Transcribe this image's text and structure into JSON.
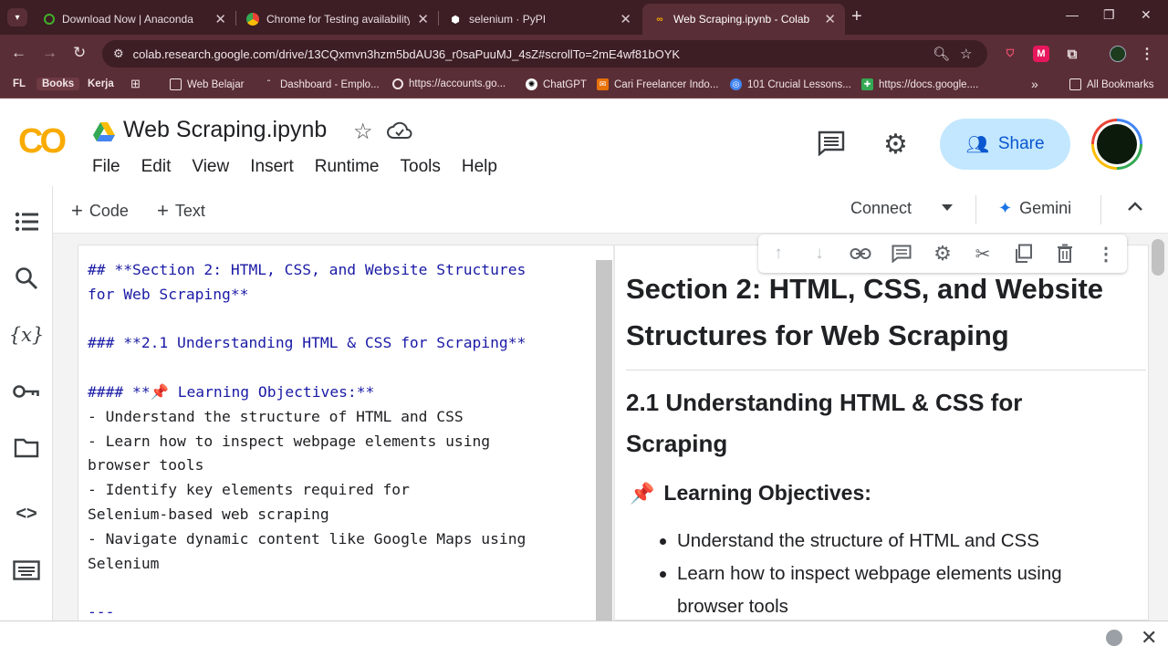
{
  "browser": {
    "tabs": [
      {
        "title": "Download Now | Anaconda",
        "icon": "anaconda-icon",
        "active": false
      },
      {
        "title": "Chrome for Testing availability",
        "icon": "chrome-icon",
        "active": false
      },
      {
        "title": "selenium · PyPI",
        "icon": "pypi-icon",
        "active": false
      },
      {
        "title": "Web Scraping.ipynb - Colab",
        "icon": "colab-icon",
        "active": true
      }
    ],
    "url": "colab.research.google.com/drive/13CQxmvn3hzm5bdAU36_r0saPuuMJ_4sZ#scrollTo=2mE4wf81bOYK",
    "bookmarks": [
      {
        "label": "FL",
        "icon": ""
      },
      {
        "label": "Books",
        "icon": ""
      },
      {
        "label": "Kerja",
        "icon": ""
      },
      {
        "label": "Web Belajar",
        "icon": "folder-icon"
      },
      {
        "label": "Dashboard - Emplo...",
        "icon": "page-icon"
      },
      {
        "label": "https://accounts.go...",
        "icon": "google-icon"
      },
      {
        "label": "ChatGPT",
        "icon": "chatgpt-icon"
      },
      {
        "label": "Cari Freelancer Indo...",
        "icon": "freelancer-icon"
      },
      {
        "label": "101 Crucial Lessons...",
        "icon": "globe-icon"
      },
      {
        "label": "https://docs.google....",
        "icon": "docs-icon"
      }
    ],
    "all_bookmarks": "All Bookmarks",
    "colors": {
      "frame": "#3c1e24",
      "toolbar": "#5a2e36"
    }
  },
  "colab": {
    "logo": "CO",
    "notebook_title": "Web Scraping.ipynb",
    "menu": [
      "File",
      "Edit",
      "View",
      "Insert",
      "Runtime",
      "Tools",
      "Help"
    ],
    "share_label": "Share",
    "toolbar": {
      "code_label": "Code",
      "text_label": "Text",
      "connect_label": "Connect",
      "gemini_label": "Gemini"
    },
    "left_rail_icons": [
      "toc-icon",
      "search-icon",
      "variables-icon",
      "secrets-key-icon",
      "files-folder-icon",
      "code-snippets-icon",
      "command-palette-icon"
    ],
    "cell_toolbar_icons": [
      "move-up-icon",
      "move-down-icon",
      "link-icon",
      "comment-icon",
      "settings-icon",
      "mirror-cell-icon",
      "copy-cell-icon",
      "delete-icon",
      "more-vert-icon"
    ]
  },
  "editor": {
    "lines": [
      "## **Section 2: HTML, CSS, and Website Structures",
      "for Web Scraping**",
      "",
      "### **2.1 Understanding HTML & CSS for Scraping**",
      "",
      "#### **📌 Learning Objectives:**",
      "- Understand the structure of HTML and CSS",
      "- Learn how to inspect webpage elements using",
      "browser tools",
      "- Identify key elements required for",
      "Selenium-based web scraping",
      "- Navigate dynamic content like Google Maps using",
      "Selenium",
      "",
      "---"
    ]
  },
  "preview": {
    "h2": "Section 2: HTML, CSS, and Website Structures for Web Scraping",
    "h3": "2.1 Understanding HTML & CSS for Scraping",
    "h4_pin": "📌",
    "h4": "Learning Objectives:",
    "bullets": [
      "Understand the structure of HTML and CSS",
      "Learn how to inspect webpage elements using browser tools"
    ]
  }
}
